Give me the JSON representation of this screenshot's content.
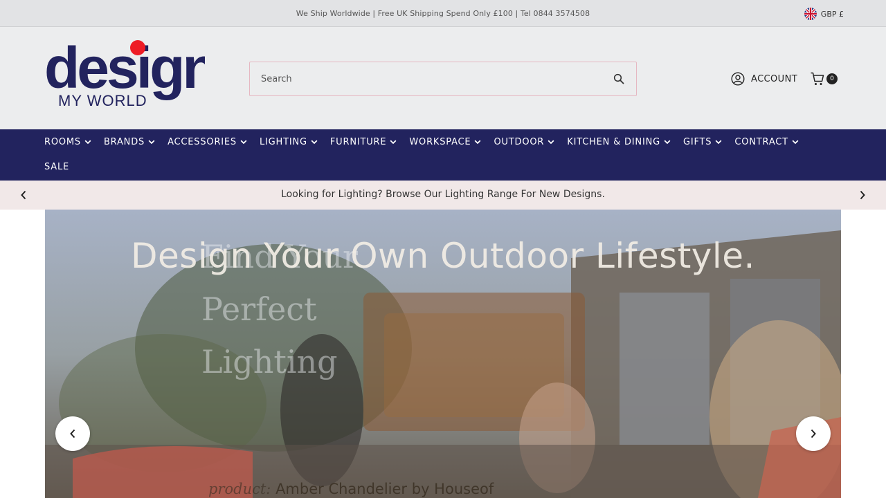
{
  "topbar": {
    "announcement": "We Ship Worldwide | Free UK Shipping Spend Only £100 | Tel 0844 3574508",
    "currency": "GBP £",
    "currency_flag_icon": "uk-flag-icon"
  },
  "header": {
    "logo": {
      "word": "design",
      "tagline": "MY WORLD",
      "dot_color": "#ee1c25",
      "text_color": "#22235e"
    },
    "search": {
      "placeholder": "Search",
      "value": ""
    },
    "account_label": "ACCOUNT",
    "cart_count": "0"
  },
  "nav": {
    "background": "#22235e",
    "items": [
      {
        "label": "ROOMS",
        "has_dropdown": true
      },
      {
        "label": "BRANDS",
        "has_dropdown": true
      },
      {
        "label": "ACCESSORIES",
        "has_dropdown": true
      },
      {
        "label": "LIGHTING",
        "has_dropdown": true
      },
      {
        "label": "FURNITURE",
        "has_dropdown": true
      },
      {
        "label": "WORKSPACE",
        "has_dropdown": true
      },
      {
        "label": "OUTDOOR",
        "has_dropdown": true
      },
      {
        "label": "KITCHEN & DINING",
        "has_dropdown": true
      },
      {
        "label": "GIFTS",
        "has_dropdown": true
      },
      {
        "label": "CONTRACT",
        "has_dropdown": true
      }
    ],
    "sale_label": "SALE"
  },
  "promo": {
    "message": "Looking for Lighting? Browse Our Lighting Range For New Designs.",
    "background": "#f1e8e8"
  },
  "hero": {
    "heading": "Design Your Own Outdoor Lifestyle.",
    "ghost_lines": [
      "Find Your",
      "Perfect",
      "Lighting"
    ],
    "caption_prefix": "product:",
    "caption": "Amber Chandelier by Houseof"
  }
}
